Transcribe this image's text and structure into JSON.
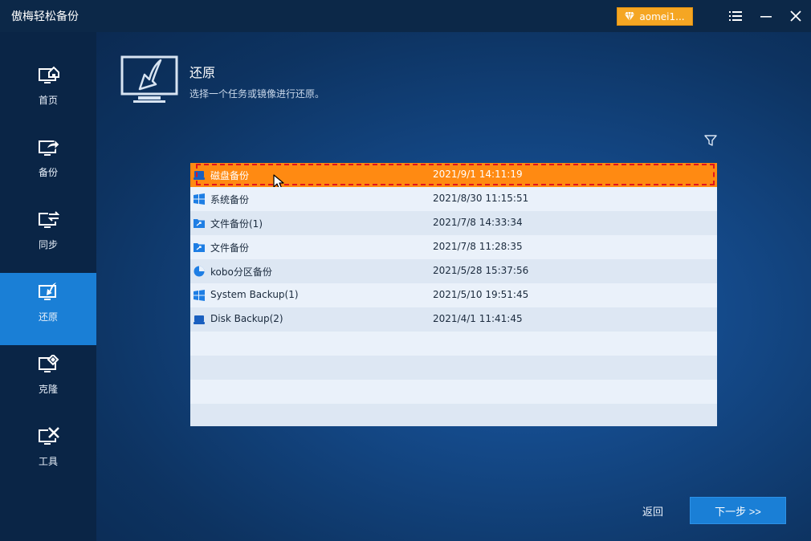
{
  "app": {
    "title": "傲梅轻松备份",
    "account_label": "aomei1..."
  },
  "sidebar": {
    "items": [
      {
        "label": "首页",
        "icon": "home-monitor-icon"
      },
      {
        "label": "备份",
        "icon": "backup-monitor-icon"
      },
      {
        "label": "同步",
        "icon": "sync-monitor-icon"
      },
      {
        "label": "还原",
        "icon": "restore-monitor-icon",
        "active": true
      },
      {
        "label": "克隆",
        "icon": "clone-monitor-icon"
      },
      {
        "label": "工具",
        "icon": "tools-monitor-icon"
      }
    ]
  },
  "page": {
    "title": "还原",
    "subtitle": "选择一个任务或镜像进行还原。"
  },
  "tasks": [
    {
      "name": "磁盘备份",
      "time": "2021/9/1 14:11:19",
      "icon": "disk-icon",
      "selected": true
    },
    {
      "name": "系统备份",
      "time": "2021/8/30 11:15:51",
      "icon": "windows-icon"
    },
    {
      "name": "文件备份(1)",
      "time": "2021/7/8 14:33:34",
      "icon": "folder-icon"
    },
    {
      "name": "文件备份",
      "time": "2021/7/8 11:28:35",
      "icon": "folder-icon"
    },
    {
      "name": "kobo分区备份",
      "time": "2021/5/28 15:37:56",
      "icon": "partition-icon"
    },
    {
      "name": "System Backup(1)",
      "time": "2021/5/10 19:51:45",
      "icon": "windows-icon"
    },
    {
      "name": "Disk Backup(2)",
      "time": "2021/4/1 11:41:45",
      "icon": "disk-icon"
    }
  ],
  "footer": {
    "back_label": "返回",
    "next_label": "下一步 >>"
  },
  "colors": {
    "accent": "#1a7fd6",
    "selected_row": "#ff8a12",
    "account": "#f5a623"
  }
}
